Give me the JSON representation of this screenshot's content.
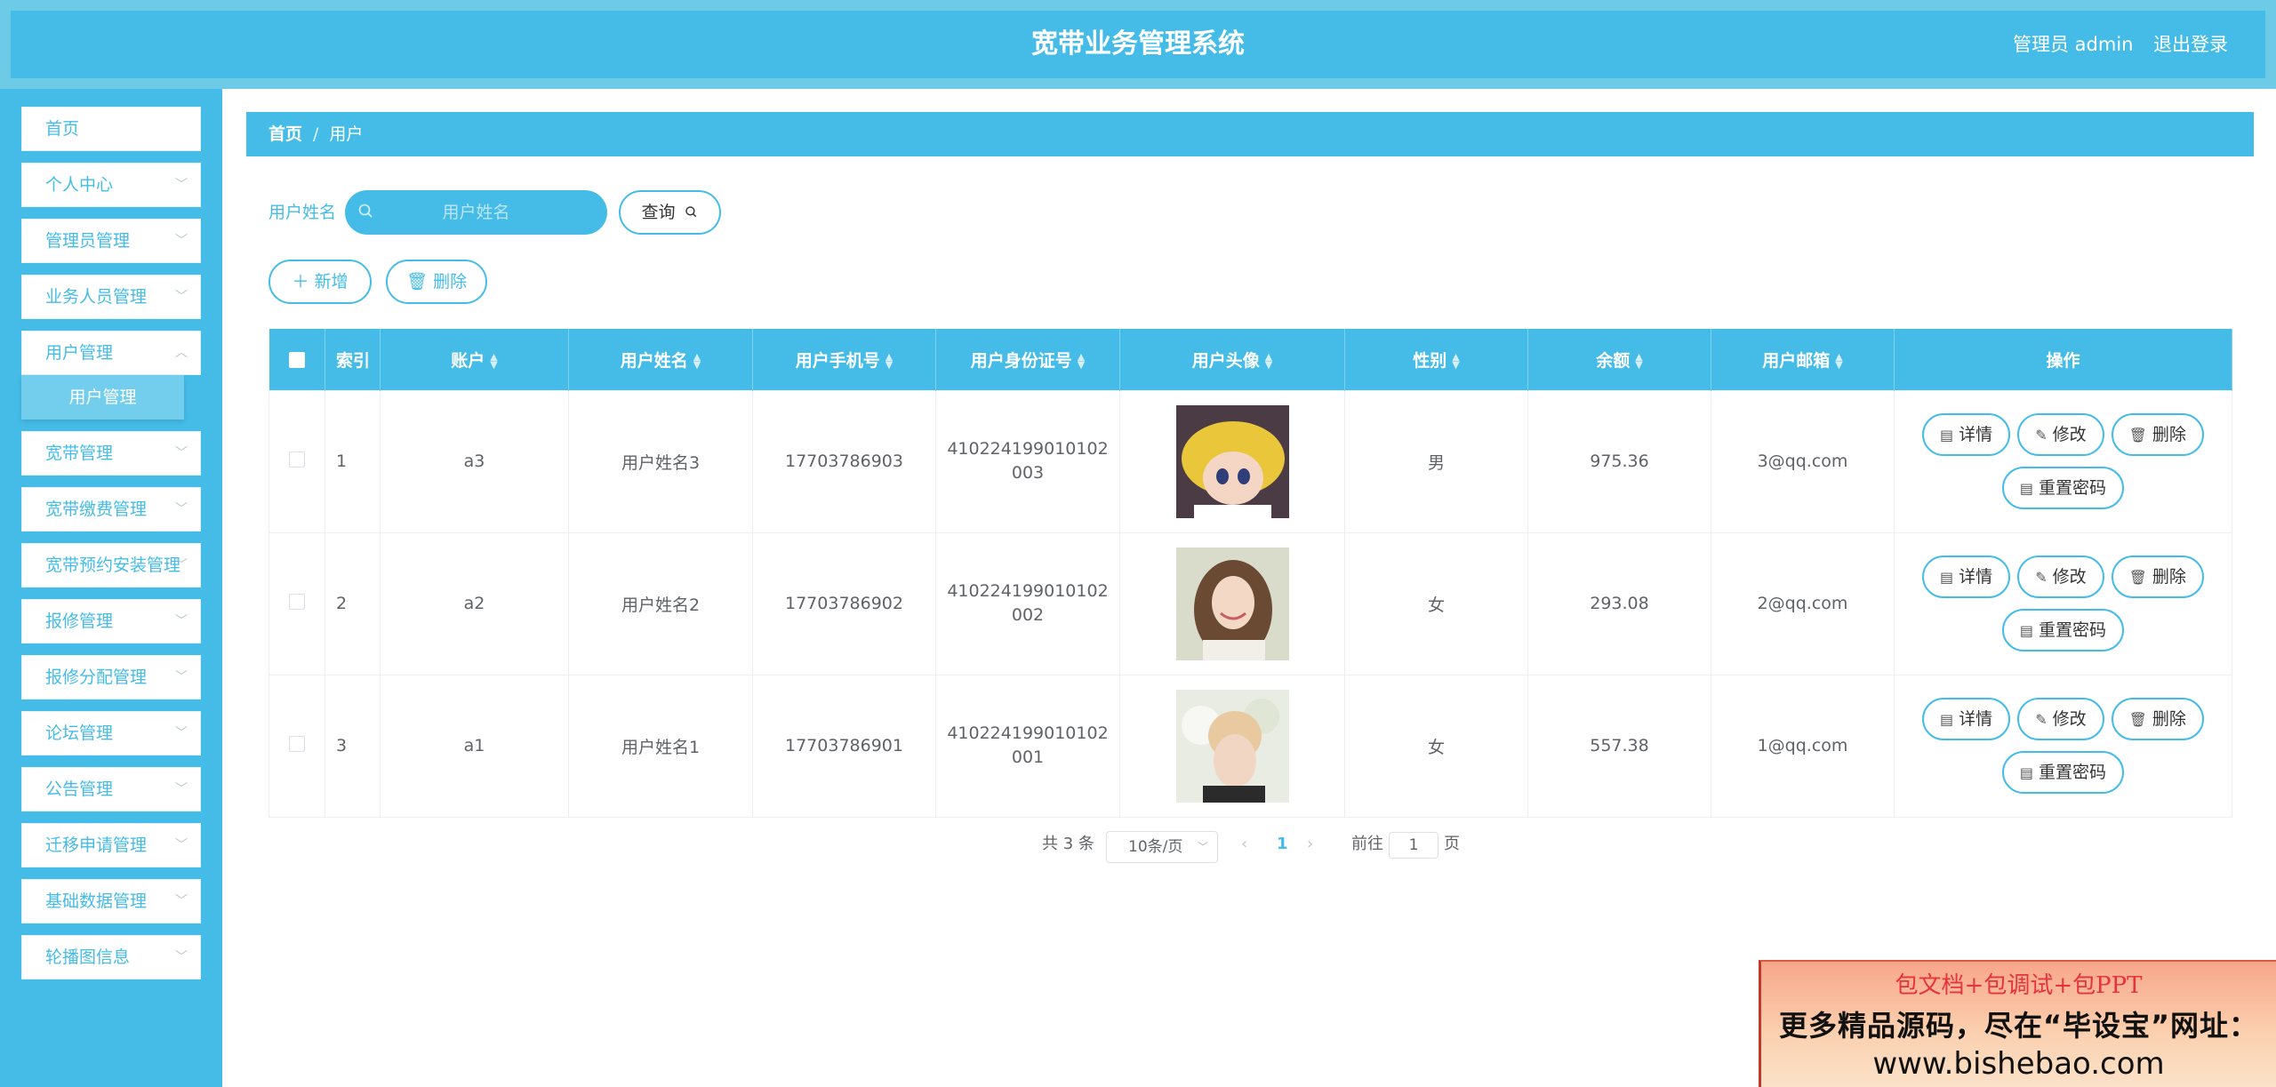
{
  "header": {
    "title": "宽带业务管理系统",
    "user_label": "管理员 admin",
    "logout_label": "退出登录"
  },
  "sidebar": {
    "items": [
      {
        "label": "首页"
      },
      {
        "label": "个人中心"
      },
      {
        "label": "管理员管理"
      },
      {
        "label": "业务人员管理"
      },
      {
        "label": "用户管理"
      },
      {
        "label": "宽带管理"
      },
      {
        "label": "宽带缴费管理"
      },
      {
        "label": "宽带预约安装管理"
      },
      {
        "label": "报修管理"
      },
      {
        "label": "报修分配管理"
      },
      {
        "label": "论坛管理"
      },
      {
        "label": "公告管理"
      },
      {
        "label": "迁移申请管理"
      },
      {
        "label": "基础数据管理"
      },
      {
        "label": "轮播图信息"
      }
    ],
    "active_sub": "用户管理"
  },
  "breadcrumb": {
    "home": "首页",
    "separator": "/",
    "current": "用户"
  },
  "search": {
    "label": "用户姓名",
    "placeholder": "用户姓名",
    "value": "",
    "query_label": "查询"
  },
  "actions": {
    "add_label": "新增",
    "delete_label": "删除"
  },
  "table": {
    "columns": [
      "索引",
      "账户",
      "用户姓名",
      "用户手机号",
      "用户身份证号",
      "用户头像",
      "性别",
      "余额",
      "用户邮箱",
      "操作"
    ],
    "rows": [
      {
        "index": "1",
        "account": "a3",
        "name": "用户姓名3",
        "phone": "17703786903",
        "idcard": "410224199010102003",
        "gender": "男",
        "balance": "975.36",
        "email": "3@qq.com"
      },
      {
        "index": "2",
        "account": "a2",
        "name": "用户姓名2",
        "phone": "17703786902",
        "idcard": "410224199010102002",
        "gender": "女",
        "balance": "293.08",
        "email": "2@qq.com"
      },
      {
        "index": "3",
        "account": "a1",
        "name": "用户姓名1",
        "phone": "17703786901",
        "idcard": "410224199010102001",
        "gender": "女",
        "balance": "557.38",
        "email": "1@qq.com"
      }
    ],
    "row_actions": {
      "detail": "详情",
      "edit": "修改",
      "delete": "删除",
      "reset_password": "重置密码"
    }
  },
  "pagination": {
    "total": "共 3 条",
    "page_size": "10条/页",
    "current_page": "1",
    "goto_prefix": "前往",
    "goto_value": "1",
    "goto_suffix": "页"
  },
  "watermark": {
    "line1": "包文档+包调试+包PPT",
    "line2": "更多精品源码，尽在“毕设宝”网址：",
    "line3": "www.bishebao.com"
  },
  "colors": {
    "primary": "#45bce8",
    "header_outer": "#6ecbe8",
    "submenu_active": "#73cdec",
    "text": "#606266"
  }
}
